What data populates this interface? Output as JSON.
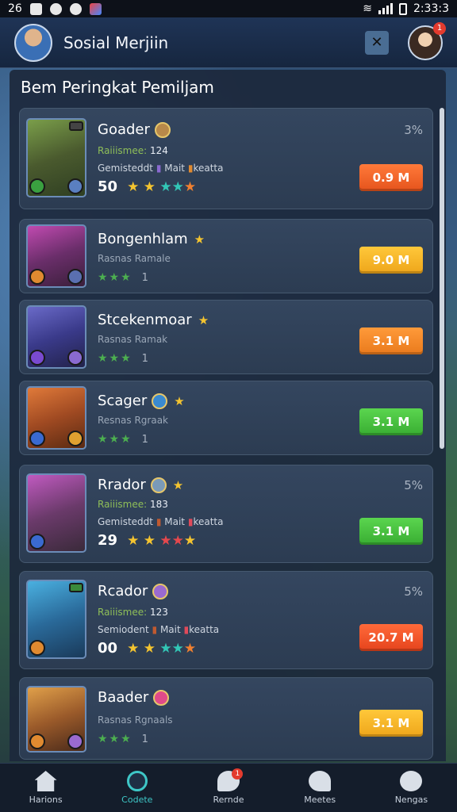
{
  "status_bar": {
    "time_left": "26",
    "time_right": "2:33:3"
  },
  "header": {
    "title": "Sosial Merjiin",
    "close_icon": "close-icon",
    "notification_count": "1"
  },
  "section": {
    "title": "Bem Peringkat Pemiljam"
  },
  "rows": [
    {
      "name": "Goader",
      "line1_label": "Raiiismee:",
      "line1_value": "124",
      "line2": "Gemisteddt",
      "line2_tag": "Mait",
      "line2_end": "keatta",
      "score": "50",
      "percent": "3%",
      "button": "0.9 M",
      "button_color": "#e5531c"
    },
    {
      "name": "Bongenhlam",
      "meta": "Rasnas Ramale",
      "stars": "★★★",
      "count": "1",
      "button": "9.0 M",
      "button_color": "#eea51a"
    },
    {
      "name": "Stcekenmoar",
      "meta": "Rasnas Ramak",
      "stars": "★★★",
      "count": "1",
      "button": "3.1 M",
      "button_color": "#e97a1c"
    },
    {
      "name": "Scager",
      "meta": "Resnas Rgraak",
      "stars": "★★★",
      "count": "1",
      "button": "3.1 M",
      "button_color": "#38ad32"
    },
    {
      "name": "Rrador",
      "line1_label": "Raiiismee:",
      "line1_value": "183",
      "line2": "Gemisteddt",
      "line2_tag": "Mait",
      "line2_end": "keatta",
      "score": "29",
      "percent": "5%",
      "button": "3.1 M",
      "button_color": "#38ad32"
    },
    {
      "name": "Rcador",
      "line1_label": "Raiiismee:",
      "line1_value": "123",
      "line2": "Semiodent",
      "line2_tag": "Mait",
      "line2_end": "keatta",
      "score": "00",
      "percent": "5%",
      "button": "20.7 M",
      "button_color": "#e5431c"
    },
    {
      "name": "Baader",
      "meta": "Rasnas Rgnaals",
      "stars": "★★★",
      "count": "1",
      "button": "3.1 M",
      "button_color": "#eea51a"
    }
  ],
  "bottom_nav": [
    {
      "label": "Harions",
      "icon": "home-icon"
    },
    {
      "label": "Codete",
      "icon": "game-icon"
    },
    {
      "label": "Rernde",
      "icon": "chat-icon",
      "badge": "1"
    },
    {
      "label": "Meetes",
      "icon": "message-icon"
    },
    {
      "label": "Nengas",
      "icon": "settings-icon"
    }
  ]
}
